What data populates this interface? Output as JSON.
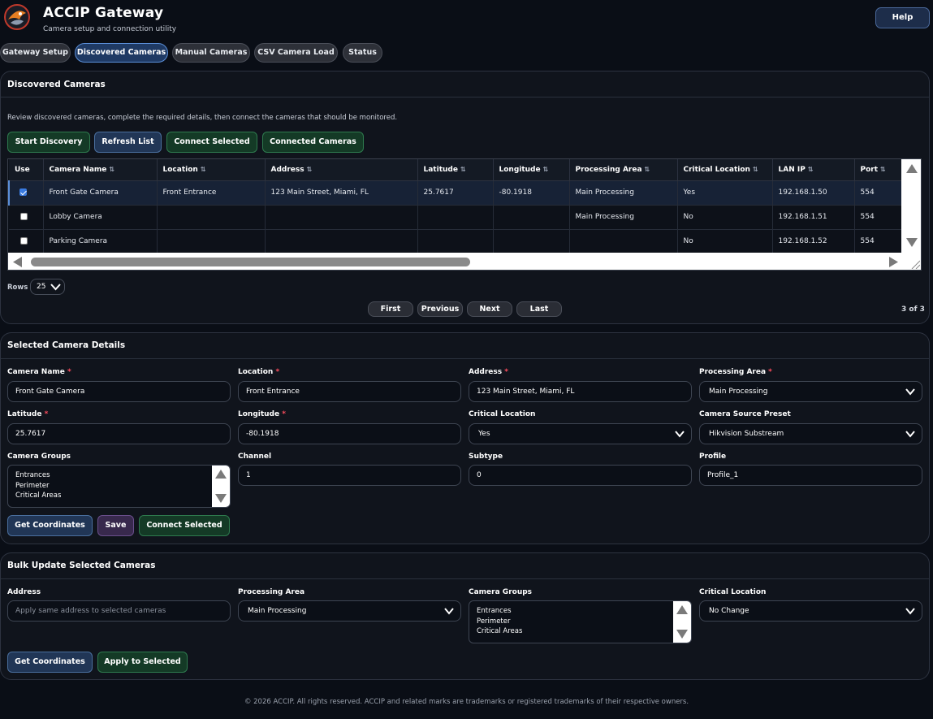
{
  "header": {
    "title": "ACCIP Gateway",
    "subtitle": "Camera setup and connection utility",
    "help_label": "Help"
  },
  "tabs": [
    {
      "label": "Gateway Setup",
      "active": false
    },
    {
      "label": "Discovered Cameras",
      "active": true
    },
    {
      "label": "Manual Cameras",
      "active": false
    },
    {
      "label": "CSV Camera Load",
      "active": false
    },
    {
      "label": "Status",
      "active": false
    }
  ],
  "discovered": {
    "title": "Discovered Cameras",
    "description": "Review discovered cameras, complete the required details, then connect the cameras that should be monitored.",
    "buttons": {
      "start_discovery": "Start Discovery",
      "refresh_list": "Refresh List",
      "connect_selected": "Connect Selected",
      "connected_cameras": "Connected Cameras"
    },
    "table": {
      "columns": [
        "Use",
        "Camera Name",
        "Location",
        "Address",
        "Latitude",
        "Longitude",
        "Processing Area",
        "Critical Location",
        "LAN IP",
        "Port"
      ],
      "sort_glyph": "⇅",
      "rows": [
        {
          "use": true,
          "camera_name": "Front Gate Camera",
          "location": "Front Entrance",
          "address": "123 Main Street, Miami, FL",
          "latitude": "25.7617",
          "longitude": "-80.1918",
          "processing_area": "Main Processing",
          "critical_location": "Yes",
          "lan_ip": "192.168.1.50",
          "port": "554"
        },
        {
          "use": false,
          "camera_name": "Lobby Camera",
          "location": "",
          "address": "",
          "latitude": "",
          "longitude": "",
          "processing_area": "Main Processing",
          "critical_location": "No",
          "lan_ip": "192.168.1.51",
          "port": "554"
        },
        {
          "use": false,
          "camera_name": "Parking Camera",
          "location": "",
          "address": "",
          "latitude": "",
          "longitude": "",
          "processing_area": "",
          "critical_location": "No",
          "lan_ip": "192.168.1.52",
          "port": "554"
        }
      ]
    },
    "rows_label": "Rows",
    "rows_value": "25",
    "pagination": {
      "first": "First",
      "previous": "Previous",
      "next": "Next",
      "last": "Last",
      "count": "3 of 3"
    }
  },
  "details": {
    "title": "Selected Camera Details",
    "camera_name_label": "Camera Name",
    "camera_name_value": "Front Gate Camera",
    "location_label": "Location",
    "location_value": "Front Entrance",
    "address_label": "Address",
    "address_value": "123 Main Street, Miami, FL",
    "processing_area_label": "Processing Area",
    "processing_area_value": "Main Processing",
    "latitude_label": "Latitude",
    "latitude_value": "25.7617",
    "longitude_label": "Longitude",
    "longitude_value": "-80.1918",
    "critical_location_label": "Critical Location",
    "critical_location_value": "Yes",
    "source_preset_label": "Camera Source Preset",
    "source_preset_value": "Hikvision Substream",
    "camera_groups_label": "Camera Groups",
    "camera_groups": [
      "Entrances",
      "Perimeter",
      "Critical Areas"
    ],
    "channel_label": "Channel",
    "channel_value": "1",
    "subtype_label": "Subtype",
    "subtype_value": "0",
    "profile_label": "Profile",
    "profile_value": "Profile_1",
    "required_mark": "*",
    "buttons": {
      "get_coordinates": "Get Coordinates",
      "save": "Save",
      "connect_selected": "Connect Selected"
    }
  },
  "bulk": {
    "title": "Bulk Update Selected Cameras",
    "address_label": "Address",
    "address_placeholder": "Apply same address to selected cameras",
    "processing_area_label": "Processing Area",
    "processing_area_value": "Main Processing",
    "camera_groups_label": "Camera Groups",
    "camera_groups": [
      "Entrances",
      "Perimeter",
      "Critical Areas"
    ],
    "critical_location_label": "Critical Location",
    "critical_location_value": "No Change",
    "buttons": {
      "get_coordinates": "Get Coordinates",
      "apply": "Apply to Selected"
    }
  },
  "footer": "© 2026 ACCIP. All rights reserved. ACCIP and related marks are trademarks or registered trademarks of their respective owners.",
  "colors": {
    "background": "#0a0e16",
    "panel": "#10141c",
    "accent_blue": "#5b8fd8",
    "green_button": "#143a26",
    "required": "#ff4d5e"
  }
}
